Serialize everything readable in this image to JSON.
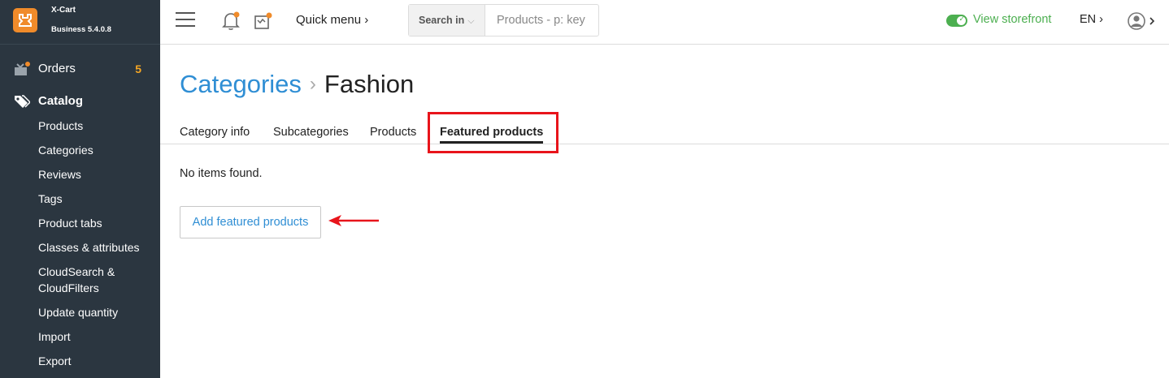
{
  "brand": {
    "name": "X-Cart",
    "edition": "Business 5.4.0.8",
    "logo_color": "#f08b2a"
  },
  "sidebar": {
    "orders": {
      "label": "Orders",
      "badge": "5"
    },
    "catalog": {
      "label": "Catalog"
    },
    "catalog_items": [
      "Products",
      "Categories",
      "Reviews",
      "Tags",
      "Product tabs",
      "Classes & attributes",
      "CloudSearch & CloudFilters",
      "Update quantity",
      "Import",
      "Export"
    ]
  },
  "topbar": {
    "quick_menu": "Quick menu ›",
    "search_in": "Search in",
    "search_placeholder": "Products - p: key",
    "view_storefront": "View storefront",
    "language": "EN ›",
    "accent_green": "#4caf50"
  },
  "page": {
    "breadcrumb_parent": "Categories",
    "breadcrumb_separator": "›",
    "title": "Fashion",
    "tabs": [
      "Category info",
      "Subcategories",
      "Products",
      "Featured products"
    ],
    "active_tab": "Featured products",
    "empty_message": "No items found.",
    "add_button": "Add featured products",
    "link_color": "#2f8ed4",
    "annotation_color": "#e8141b"
  }
}
